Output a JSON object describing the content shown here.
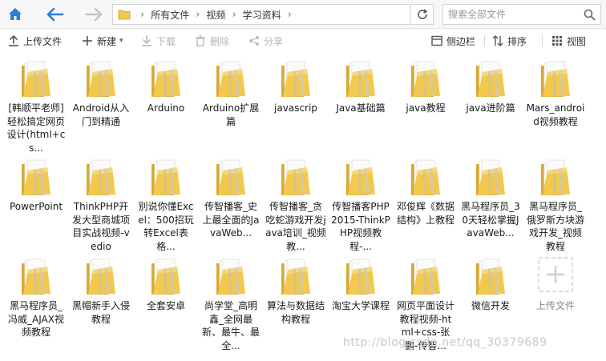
{
  "nav": {
    "breadcrumbs": [
      "所有文件",
      "视频",
      "学习资料"
    ],
    "search_placeholder": "搜索全部文件"
  },
  "toolbar": {
    "upload": "上传文件",
    "new": "新建",
    "download": "下载",
    "delete": "删除",
    "share": "分享",
    "sidebar": "侧边栏",
    "sort": "排序",
    "view": "视图"
  },
  "colors": {
    "accent": "#2b7fd6",
    "folder": "#f2c94c",
    "folder_dark": "#d9a934"
  },
  "folders": [
    {
      "name": "[韩顺平老师]轻松搞定网页设计(html+cs..."
    },
    {
      "name": "Android从入门到精通"
    },
    {
      "name": "Arduino"
    },
    {
      "name": "Arduino扩展篇"
    },
    {
      "name": "javascrip"
    },
    {
      "name": "Java基础篇"
    },
    {
      "name": "java教程"
    },
    {
      "name": "java进阶篇"
    },
    {
      "name": "Mars_android视频教程"
    },
    {
      "name": "PowerPoint"
    },
    {
      "name": "ThinkPHP开发大型商城项目实战视频-vedio"
    },
    {
      "name": "别说你懂Excel：500招玩转Excel表格..."
    },
    {
      "name": "传智播客_史上最全面的JavaWeb..."
    },
    {
      "name": "传智播客_贪吃蛇游戏开发java培训_视频教..."
    },
    {
      "name": "传智播客PHP2015-ThinkPHP视频教程-..."
    },
    {
      "name": "邓俊辉《数据结构》上教程"
    },
    {
      "name": "黑马程序员_30天轻松掌握JavaWeb..."
    },
    {
      "name": "黑马程序员_俄罗斯方块游戏开发_视频教程"
    },
    {
      "name": "黑马程序员_冯威_AJAX视频教程"
    },
    {
      "name": "黑帽新手入侵教程"
    },
    {
      "name": "全套安卓"
    },
    {
      "name": "尚学堂_高明鑫_全网最新、最牛、最全..."
    },
    {
      "name": "算法与数据结构教程"
    },
    {
      "name": "淘宝大学课程"
    },
    {
      "name": "网页平面设计教程视频-html+css-张鹏-传智..."
    },
    {
      "name": "微信开发"
    }
  ],
  "upload_tile": {
    "label": "上传文件"
  },
  "watermark": "http://blog.csdn.net/qq_30379689"
}
